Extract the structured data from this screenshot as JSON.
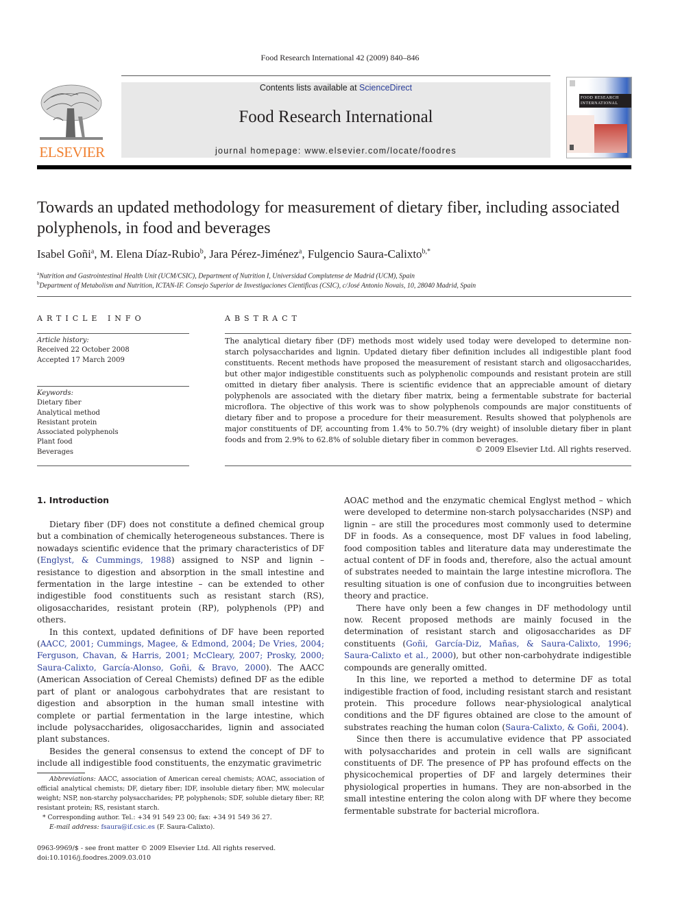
{
  "running_head": "Food Research International 42 (2009) 840–846",
  "masthead": {
    "publisher_wordmark": "ELSEVIER",
    "contents_prefix": "Contents lists available at ",
    "contents_link": "ScienceDirect",
    "journal_title": "Food Research International",
    "homepage": "journal homepage: www.elsevier.com/locate/foodres",
    "cover_label_line1": "FOOD RESEARCH",
    "cover_label_line2": "INTERNATIONAL",
    "colors": {
      "elsevier_orange": "#f07f2e",
      "link_blue": "#2b3f9a",
      "banner_gray": "#e8e8e8"
    }
  },
  "article": {
    "title": "Towards an updated methodology for measurement of dietary fiber, including associated polyphenols, in food and beverages",
    "authors": [
      {
        "name": "Isabel Goñi",
        "sup": "a",
        "sep": ", "
      },
      {
        "name": "M. Elena Díaz-Rubio",
        "sup": "b",
        "sep": ", "
      },
      {
        "name": "Jara Pérez-Jiménez",
        "sup": "a",
        "sep": ", "
      },
      {
        "name": "Fulgencio Saura-Calixto",
        "sup": "b,*",
        "sep": ""
      }
    ],
    "affiliations": [
      {
        "sup": "a",
        "text": "Nutrition and Gastrointestinal Health Unit (UCM/CSIC), Department of Nutrition I, Universidad Complutense de Madrid (UCM), Spain"
      },
      {
        "sup": "b",
        "text": "Department of Metabolism and Nutrition, ICTAN-IF. Consejo Superior de Investigaciones Cientificas (CSIC), c/José Antonio Novais, 10, 28040 Madrid, Spain"
      }
    ]
  },
  "article_info": {
    "heading": "ARTICLE INFO",
    "history_label": "Article history:",
    "received": "Received 22 October 2008",
    "accepted": "Accepted 17 March 2009",
    "keywords_label": "Keywords:",
    "keywords": [
      "Dietary fiber",
      "Analytical method",
      "Resistant protein",
      "Associated polyphenols",
      "Plant food",
      "Beverages"
    ]
  },
  "abstract": {
    "heading": "ABSTRACT",
    "text": "The analytical dietary fiber (DF) methods most widely used today were developed to determine non-starch polysaccharides and lignin. Updated dietary fiber definition includes all indigestible plant food constituents. Recent methods have proposed the measurement of resistant starch and oligosaccharides, but other major indigestible constituents such as polyphenolic compounds and resistant protein are still omitted in dietary fiber analysis. There is scientific evidence that an appreciable amount of dietary polyphenols are associated with the dietary fiber matrix, being a fermentable substrate for bacterial microflora. The objective of this work was to show polyphenols compounds are major constituents of dietary fiber and to propose a procedure for their measurement. Results showed that polyphenols are major constituents of DF, accounting from 1.4% to 50.7% (dry weight) of insoluble dietary fiber in plant foods and from 2.9% to 62.8% of soluble dietary fiber in common beverages.",
    "copyright": "© 2009 Elsevier Ltd. All rights reserved."
  },
  "body": {
    "section_heading": "1. Introduction",
    "left": {
      "p1_a": "Dietary fiber (DF) does not constitute a defined chemical group but a combination of chemically heterogeneous substances. There is nowadays scientific evidence that the primary characteristics of DF (",
      "p1_cite": "Englyst, & Cummings, 1988",
      "p1_b": ") assigned to NSP and lignin – resistance to digestion and absorption in the small intestine and fermentation in the large intestine – can be extended to other indigestible food constituents such as resistant starch (RS), oligosaccharides, resistant protein (RP), polyphenols (PP) and others.",
      "p2_a": "In this context, updated definitions of DF have been reported (",
      "p2_cite": "AACC, 2001; Cummings, Magee, & Edmond, 2004; De Vries, 2004; Ferguson, Chavan, & Harris, 2001; McCleary, 2007; Prosky, 2000; Saura-Calixto, García-Alonso, Goñi, & Bravo, 2000",
      "p2_b": "). The AACC (American Association of Cereal Chemists) defined DF as the edible part of plant or analogous carbohydrates that are resistant to digestion and absorption in the human small intestine with complete or partial fermentation in the large intestine, which include polysaccharides, oligosaccharides, lignin and associated plant substances.",
      "p3": "Besides the general consensus to extend the concept of DF to include all indigestible food constituents, the enzymatic gravimetric"
    },
    "right": {
      "p1": "AOAC method and the enzymatic chemical Englyst method – which were developed to determine non-starch polysaccharides (NSP) and lignin – are still the procedures most commonly used to determine DF in foods. As a consequence, most DF values in food labeling, food composition tables and literature data may underestimate the actual content of DF in foods and, therefore, also the actual amount of substrates needed to maintain the large intestine microflora. The resulting situation is one of confusion due to incongruities between theory and practice.",
      "p2_a": "There have only been a few changes in DF methodology until now. Recent proposed methods are mainly focused in the determination of resistant starch and oligosaccharides as DF constituents (",
      "p2_cite": "Goñi, García-Diz, Mañas, & Saura-Calixto, 1996; Saura-Calixto et al., 2000",
      "p2_b": "), but other non-carbohydrate indigestible compounds are generally omitted.",
      "p3_a": "In this line, we reported a method to determine DF as total indigestible fraction of food, including resistant starch and resistant protein. This procedure follows near-physiological analytical conditions and the DF figures obtained are close to the amount of substrates reaching the human colon (",
      "p3_cite": "Saura-Calixto, & Goñi, 2004",
      "p3_b": ").",
      "p4": "Since then there is accumulative evidence that PP associated with polysaccharides and protein in cell walls are significant constituents of DF. The presence of PP has profound effects on the physicochemical properties of DF and largely determines their physiological properties in humans. They are non-absorbed in the small intestine entering the colon along with DF where they become fermentable substrate for bacterial microflora."
    }
  },
  "footnotes": {
    "abbrev_label": "Abbreviations:",
    "abbrev_text": " AACC, association of American cereal chemists; AOAC, association of official analytical chemists; DF, dietary fiber; IDF, insoluble dietary fiber; MW, molecular weight; NSP, non-starchy polysaccharides; PP, polyphenols; SDF, soluble dietary fiber; RP, resistant protein; RS, resistant starch.",
    "corresponding": "*  Corresponding author. Tel.: +34 91 549 23 00; fax: +34 91 549 36 27.",
    "email_label": "E-mail address:",
    "email": "fsaura@if.csic.es",
    "email_owner": " (F. Saura-Calixto)."
  },
  "bottom_meta": {
    "issn_line": "0963-9969/$ - see front matter © 2009 Elsevier Ltd. All rights reserved.",
    "doi": "doi:10.1016/j.foodres.2009.03.010"
  }
}
